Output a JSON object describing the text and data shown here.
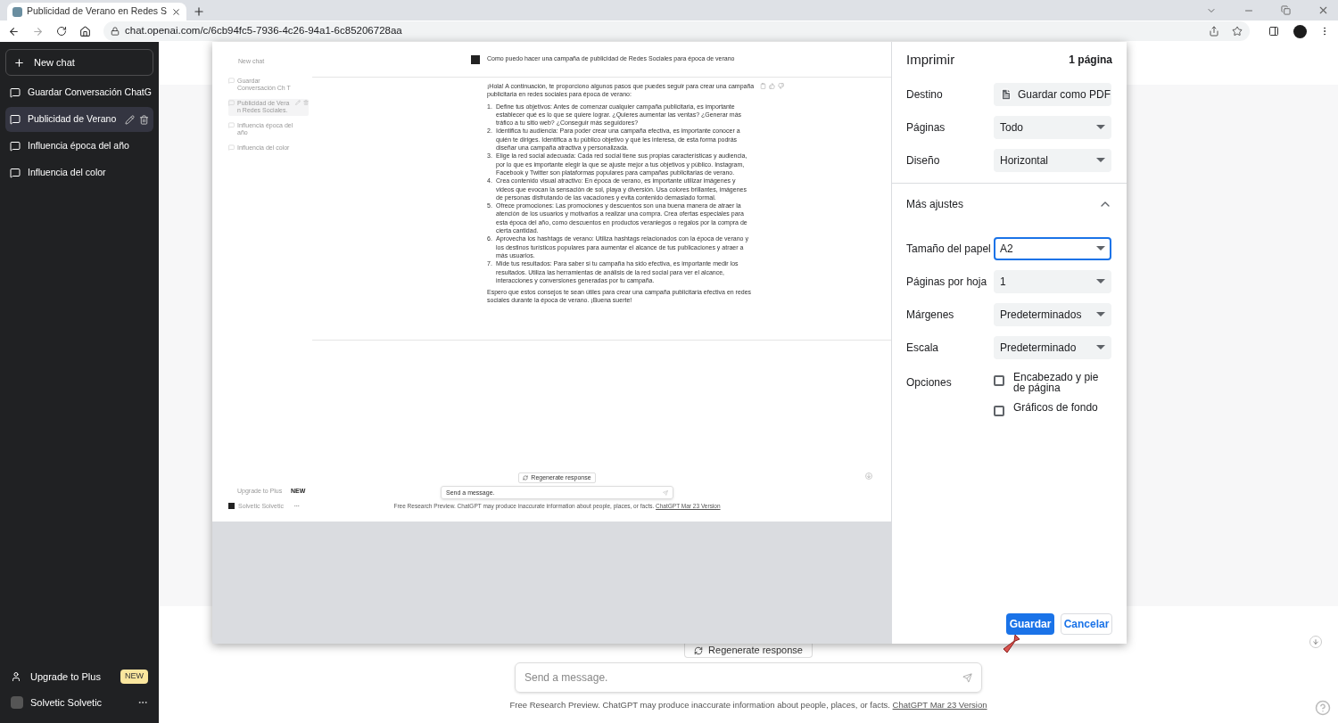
{
  "browser": {
    "tab_title": "Publicidad de Verano en Redes S",
    "url": "chat.openai.com/c/6cb94fc5-7936-4c26-94a1-6c85206728aa"
  },
  "sidebar": {
    "new_chat": "New chat",
    "chats": [
      {
        "title": "Guardar Conversación ChatG",
        "selected": false
      },
      {
        "title": "Publicidad de Verano",
        "selected": true
      },
      {
        "title": "Influencia época del año",
        "selected": false
      },
      {
        "title": "Influencia del color",
        "selected": false
      }
    ],
    "upgrade": "Upgrade to Plus",
    "upgrade_badge": "NEW",
    "user": "Solvetic Solvetic"
  },
  "chat": {
    "regenerate": "Regenerate response",
    "message_placeholder": "Send a message.",
    "footer": "Free Research Preview. ChatGPT may produce inaccurate information about people, places, or facts.",
    "footer_link": "ChatGPT Mar 23 Version"
  },
  "print_preview": {
    "sidebar": {
      "new_chat": "New chat",
      "chats": [
        {
          "title": "Guardar Conversación Ch T",
          "selected": false
        },
        {
          "title": "Publicidad de Vera n Redes Sociales.",
          "selected": true
        },
        {
          "title": "Influencia época del año",
          "selected": false
        },
        {
          "title": "Influencia del color",
          "selected": false
        }
      ],
      "upgrade": "Upgrade to Plus",
      "upgrade_badge": "NEW",
      "user": "Solvetic Solvetic"
    },
    "question": "Como puedo hacer una campaña de publicidad de Redes Sociales para época de verano",
    "intro": "¡Hola! A continuación, te proporciono algunos pasos que puedes seguir para crear una campaña publicitaria en redes sociales para época de verano:",
    "steps": [
      {
        "number": "1.",
        "text": "Define tus objetivos: Antes de comenzar cualquier campaña publicitaria, es importante establecer qué es lo que se quiere lograr. ¿Quieres aumentar las ventas? ¿Generar más tráfico a tu sitio web? ¿Conseguir más seguidores?"
      },
      {
        "number": "2.",
        "text": "Identifica tu audiencia: Para poder crear una campaña efectiva, es importante conocer a quién te diriges. Identifica a tu público objetivo y qué les interesa, de esta forma podrás diseñar una campaña atractiva y personalizada."
      },
      {
        "number": "3.",
        "text": "Elige la red social adecuada: Cada red social tiene sus propias características y audiencia, por lo que es importante elegir la que se ajuste mejor a tus objetivos y público. Instagram, Facebook y Twitter son plataformas populares para campañas publicitarias de verano."
      },
      {
        "number": "4.",
        "text": "Crea contenido visual atractivo: En época de verano, es importante utilizar imágenes y videos que evocan la sensación de sol, playa y diversión. Usa colores brillantes, imágenes de personas disfrutando de las vacaciones y evita contenido demasiado formal."
      },
      {
        "number": "5.",
        "text": "Ofrece promociones: Las promociones y descuentos son una buena manera de atraer la atención de los usuarios y motivarlos a realizar una compra. Crea ofertas especiales para esta época del año, como descuentos en productos veraniegos o regalos por la compra de cierta cantidad."
      },
      {
        "number": "6.",
        "text": "Aprovecha los hashtags de verano: Utiliza hashtags relacionados con la época de verano y los destinos turísticos populares para aumentar el alcance de tus publicaciones y atraer a más usuarios."
      },
      {
        "number": "7.",
        "text": "Mide tus resultados: Para saber si tu campaña ha sido efectiva, es importante medir los resultados. Utiliza las herramientas de análisis de la red social para ver el alcance, interacciones y conversiones generadas por tu campaña."
      }
    ],
    "closing": "Espero que estos consejos te sean útiles para crear una campaña publicitaria efectiva en redes sociales durante la época de verano. ¡Buena suerte!",
    "regenerate": "Regenerate response",
    "message_placeholder": "Send a message.",
    "footer": "Free Research Preview. ChatGPT may produce inaccurate information about people, places, or facts.",
    "footer_link": "ChatGPT Mar 23 Version"
  },
  "print_dialog": {
    "title": "Imprimir",
    "page_count": "1 página",
    "settings": [
      {
        "label": "Destino",
        "value": "Guardar como PDF",
        "kind": "pdf",
        "focused": false
      },
      {
        "label": "Páginas",
        "value": "Todo",
        "kind": "plain",
        "focused": false
      },
      {
        "label": "Diseño",
        "value": "Horizontal",
        "kind": "plain",
        "focused": false
      }
    ],
    "more_settings": {
      "label": "Más ajustes",
      "expanded": true
    },
    "extra_settings": [
      {
        "label": "Tamaño del papel",
        "value": "A2",
        "kind": "plain",
        "focused": true
      },
      {
        "label": "Páginas por hoja",
        "value": "1",
        "kind": "plain",
        "focused": false
      },
      {
        "label": "Márgenes",
        "value": "Predeterminados",
        "kind": "plain",
        "focused": false
      },
      {
        "label": "Escala",
        "value": "Predeterminado",
        "kind": "plain",
        "focused": false
      }
    ],
    "options_label": "Opciones",
    "options": [
      {
        "label": "Encabezado y pie de página",
        "checked": false
      },
      {
        "label": "Gráficos de fondo",
        "checked": false
      }
    ],
    "save": "Guardar",
    "cancel": "Cancelar"
  }
}
